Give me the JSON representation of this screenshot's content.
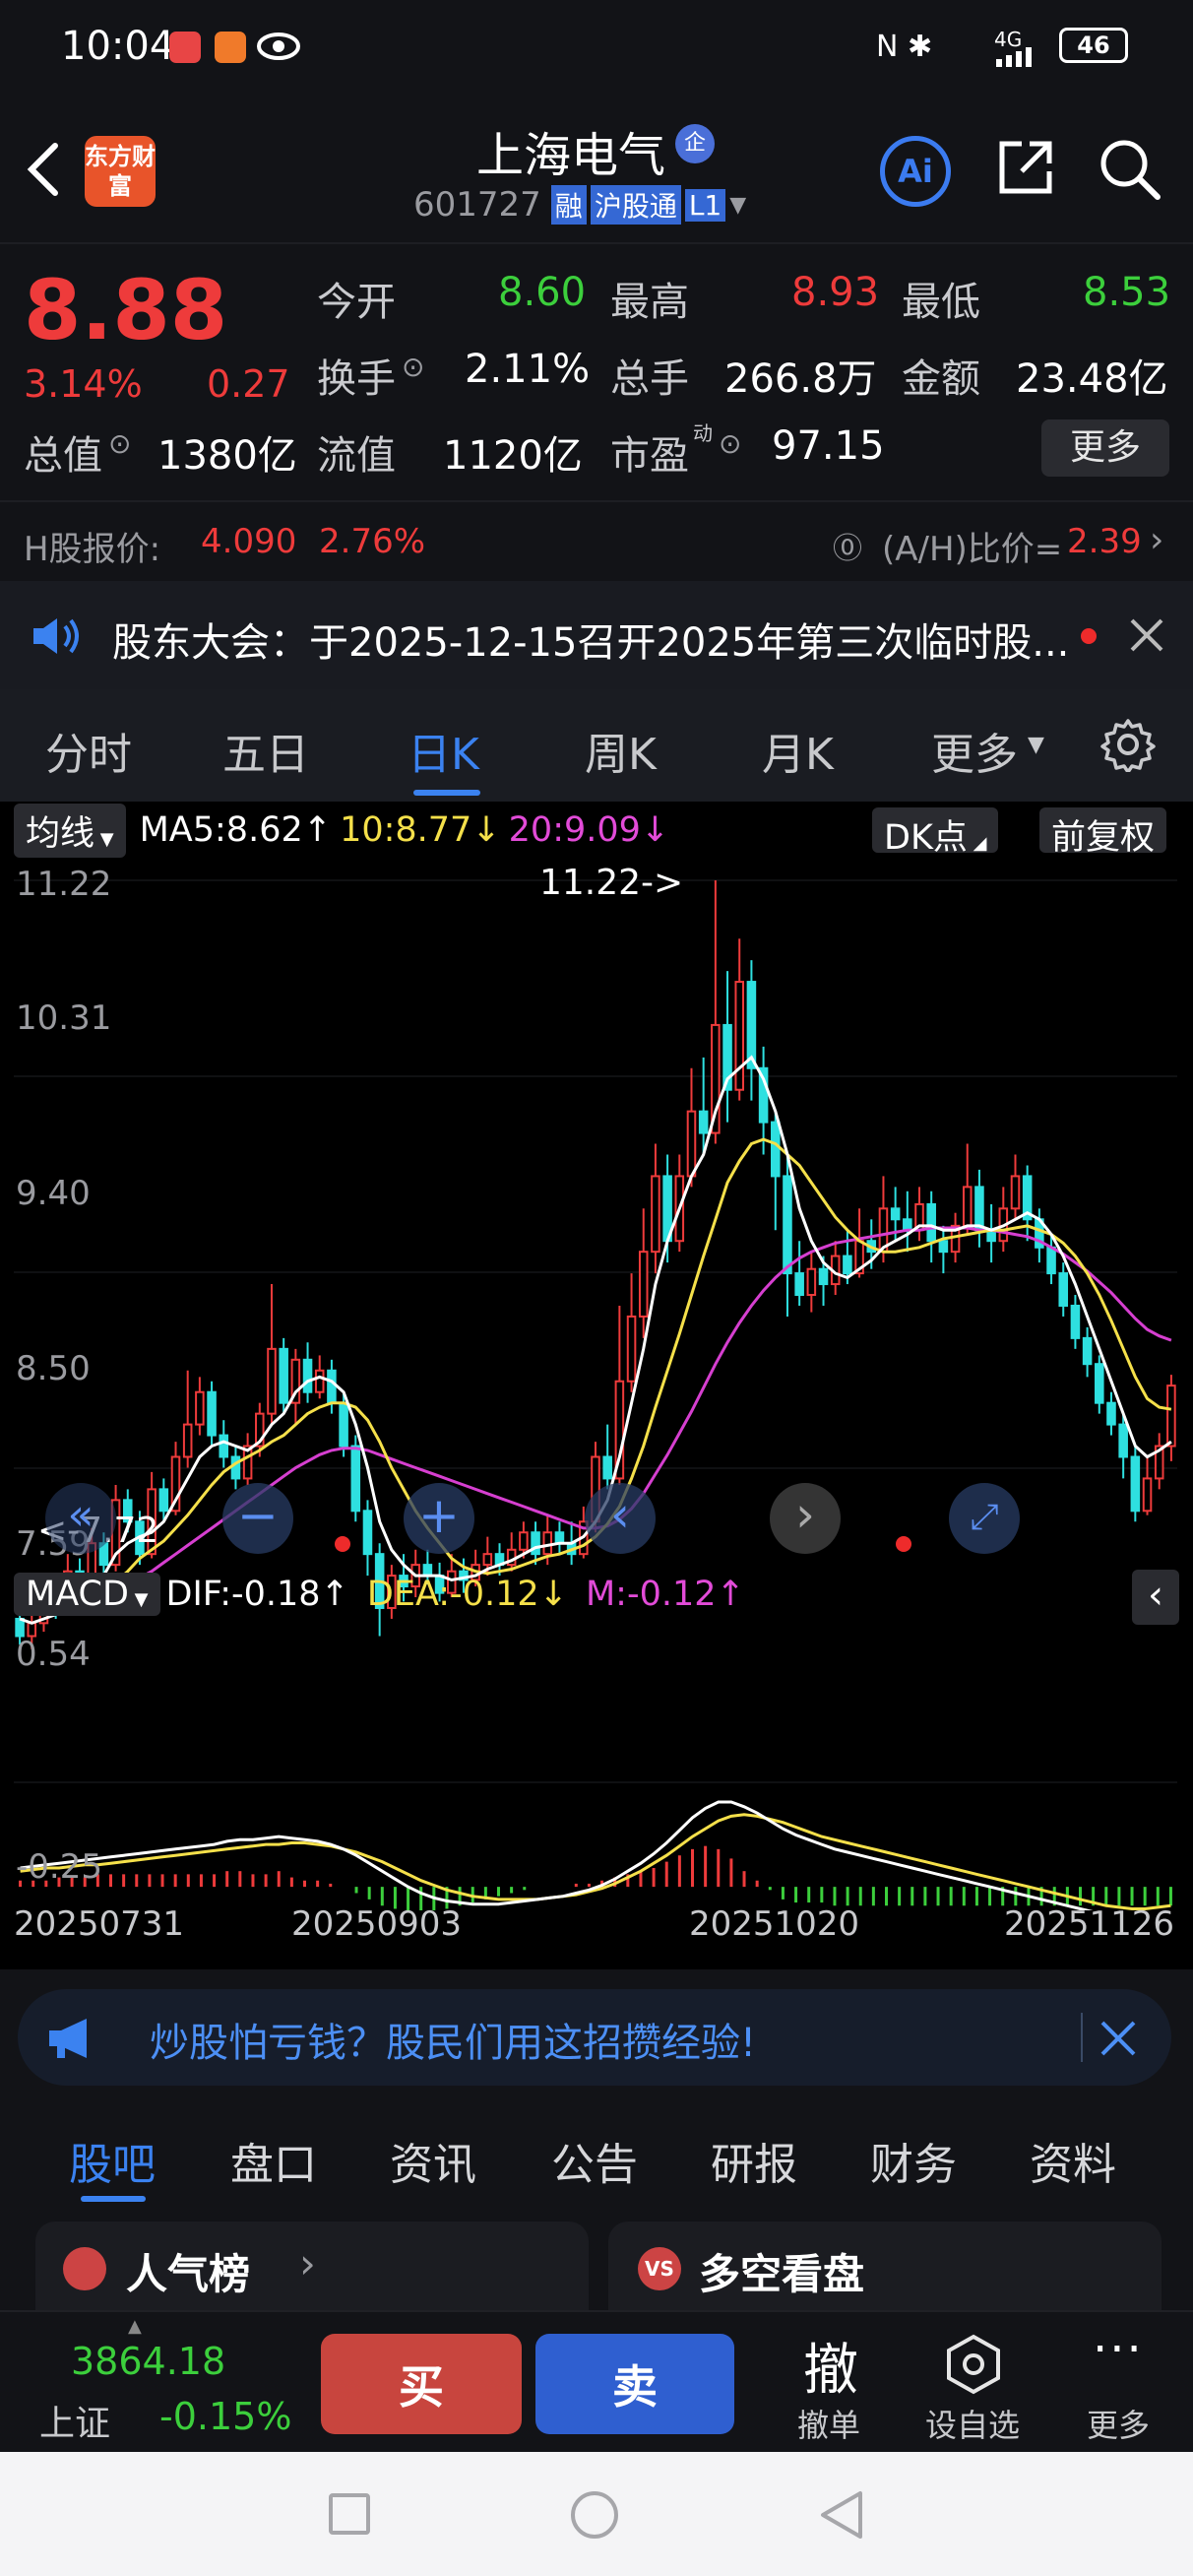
{
  "status_bar": {
    "time": "10:04",
    "net": "4G",
    "battery": "46"
  },
  "header": {
    "title": "上海电气",
    "badge": "企",
    "code": "601727",
    "tags": [
      "融",
      "沪股通",
      "L1"
    ],
    "logo_text": "东方财富",
    "ai_label": "Ai"
  },
  "quote": {
    "price": "8.88",
    "change_pct": "3.14%",
    "change_amt": "0.27",
    "open_label": "今开",
    "open": "8.60",
    "high_label": "最高",
    "high": "8.93",
    "low_label": "最低",
    "low": "8.53",
    "turnover_label": "换手",
    "turnover": "2.11%",
    "volume_label": "总手",
    "volume": "266.8万",
    "amount_label": "金额",
    "amount": "23.48亿",
    "mktcap_label": "总值",
    "mktcap": "1380亿",
    "float_label": "流值",
    "float_cap": "1120亿",
    "pe_label": "市盈",
    "pe_sup": "动",
    "pe": "97.15",
    "more_label": "更多"
  },
  "hshare": {
    "label": "H股报价:",
    "price": "4.090",
    "change": "2.76%",
    "ratio_label": "(A/H)比价=",
    "ratio": "2.39"
  },
  "notice": {
    "text": "股东大会：于2025-12-15召开2025年第三次临时股..."
  },
  "period_tabs": [
    "分时",
    "五日",
    "日K",
    "周K",
    "月K",
    "更多"
  ],
  "active_tab": "日K",
  "ma_bar": {
    "type": "均线",
    "ma5": "MA5:8.62",
    "ma10": "10:8.77",
    "ma20": "20:9.09",
    "dk": "DK点",
    "adj": "前复权"
  },
  "price_axis": [
    "11.22",
    "10.31",
    "9.40",
    "8.50",
    "7.59"
  ],
  "annotations": {
    "max": "11.22->",
    "min": "<-7.72"
  },
  "macd_bar": {
    "type": "MACD",
    "dif": "DIF:-0.18",
    "dea": "DEA:-0.12",
    "m": "M:-0.12"
  },
  "macd_axis": [
    "0.54",
    "-0.25"
  ],
  "date_axis": [
    "20250731",
    "20250903",
    "20251020",
    "20251126"
  ],
  "ad": {
    "text": "炒股怕亏钱？股民们用这招攒经验!"
  },
  "sub_tabs": [
    "股吧",
    "盘口",
    "资讯",
    "公告",
    "研报",
    "财务",
    "资料"
  ],
  "active_sub_tab": "股吧",
  "cards": {
    "popular": "人气榜",
    "bullbear": "多空看盘"
  },
  "bottom": {
    "index_value": "3864.18",
    "index_name": "上证",
    "index_change": "-0.15%",
    "buy": "买",
    "sell": "卖",
    "cancel_icon": "撤",
    "cancel": "撤单",
    "watch": "设自选",
    "more": "更多"
  },
  "colors": {
    "up": "#ee3b3b",
    "down": "#2ee0e0",
    "ma5": "#ffffff",
    "ma10": "#f5e04a",
    "ma20": "#d63fd0",
    "accent": "#3b82f0"
  },
  "chart_data": {
    "type": "candlestick",
    "ylim": [
      7.59,
      11.22
    ],
    "annotations": {
      "max": 11.22,
      "min": 7.72
    },
    "candles": [
      [
        7.8,
        7.72,
        7.95,
        7.68
      ],
      [
        7.72,
        7.78,
        7.85,
        7.66
      ],
      [
        7.78,
        7.9,
        7.98,
        7.74
      ],
      [
        7.9,
        7.84,
        7.96,
        7.8
      ],
      [
        7.84,
        8.02,
        8.1,
        7.82
      ],
      [
        8.02,
        7.95,
        8.08,
        7.9
      ],
      [
        7.95,
        8.15,
        8.22,
        7.92
      ],
      [
        8.15,
        8.05,
        8.2,
        8.0
      ],
      [
        8.05,
        8.35,
        8.42,
        8.02
      ],
      [
        8.35,
        8.25,
        8.4,
        8.2
      ],
      [
        8.25,
        8.1,
        8.3,
        8.05
      ],
      [
        8.1,
        8.4,
        8.48,
        8.08
      ],
      [
        8.4,
        8.3,
        8.45,
        8.25
      ],
      [
        8.3,
        8.55,
        8.62,
        8.28
      ],
      [
        8.55,
        8.7,
        8.95,
        8.5
      ],
      [
        8.7,
        8.85,
        8.92,
        8.65
      ],
      [
        8.85,
        8.65,
        8.9,
        8.6
      ],
      [
        8.65,
        8.55,
        8.72,
        8.5
      ],
      [
        8.55,
        8.45,
        8.6,
        8.4
      ],
      [
        8.45,
        8.6,
        8.66,
        8.42
      ],
      [
        8.6,
        8.75,
        8.8,
        8.55
      ],
      [
        8.75,
        9.05,
        9.35,
        8.7
      ],
      [
        9.05,
        8.8,
        9.1,
        8.75
      ],
      [
        8.8,
        9.0,
        9.05,
        8.7
      ],
      [
        9.0,
        8.85,
        9.08,
        8.8
      ],
      [
        8.85,
        8.95,
        9.02,
        8.82
      ],
      [
        8.95,
        8.8,
        9.0,
        8.75
      ],
      [
        8.8,
        8.6,
        8.85,
        8.55
      ],
      [
        8.6,
        8.3,
        8.65,
        8.25
      ],
      [
        8.3,
        8.1,
        8.35,
        8.0
      ],
      [
        8.1,
        7.85,
        8.15,
        7.72
      ],
      [
        7.85,
        8.0,
        8.05,
        7.8
      ],
      [
        8.0,
        7.95,
        8.1,
        7.88
      ],
      [
        7.95,
        8.05,
        8.12,
        7.9
      ],
      [
        8.05,
        8.0,
        8.12,
        7.96
      ],
      [
        8.0,
        7.92,
        8.06,
        7.88
      ],
      [
        7.92,
        8.02,
        8.1,
        7.9
      ],
      [
        8.02,
        7.98,
        8.08,
        7.92
      ],
      [
        7.98,
        8.05,
        8.12,
        7.95
      ],
      [
        8.05,
        8.1,
        8.18,
        8.0
      ],
      [
        8.1,
        8.05,
        8.15,
        8.0
      ],
      [
        8.05,
        8.12,
        8.2,
        8.02
      ],
      [
        8.12,
        8.2,
        8.25,
        8.08
      ],
      [
        8.2,
        8.1,
        8.25,
        8.05
      ],
      [
        8.1,
        8.2,
        8.28,
        8.05
      ],
      [
        8.2,
        8.15,
        8.25,
        8.1
      ],
      [
        8.15,
        8.1,
        8.25,
        8.05
      ],
      [
        8.1,
        8.25,
        8.32,
        8.08
      ],
      [
        8.25,
        8.55,
        8.62,
        8.2
      ],
      [
        8.55,
        8.45,
        8.7,
        8.4
      ],
      [
        8.45,
        8.9,
        9.25,
        8.42
      ],
      [
        8.9,
        9.2,
        9.4,
        8.85
      ],
      [
        9.2,
        9.5,
        9.7,
        9.1
      ],
      [
        9.5,
        9.85,
        10.0,
        9.4
      ],
      [
        9.85,
        9.55,
        9.95,
        9.45
      ],
      [
        9.55,
        9.85,
        9.95,
        9.5
      ],
      [
        9.85,
        10.15,
        10.35,
        9.8
      ],
      [
        10.15,
        10.05,
        10.4,
        9.95
      ],
      [
        10.05,
        10.55,
        11.22,
        10.0
      ],
      [
        10.55,
        10.25,
        10.8,
        10.1
      ],
      [
        10.25,
        10.75,
        10.95,
        10.2
      ],
      [
        10.75,
        10.35,
        10.85,
        10.2
      ],
      [
        10.35,
        10.1,
        10.45,
        9.95
      ],
      [
        10.1,
        9.85,
        10.15,
        9.6
      ],
      [
        9.85,
        9.4,
        9.95,
        9.2
      ],
      [
        9.4,
        9.3,
        9.55,
        9.25
      ],
      [
        9.3,
        9.42,
        9.5,
        9.22
      ],
      [
        9.42,
        9.35,
        9.48,
        9.25
      ],
      [
        9.35,
        9.48,
        9.55,
        9.3
      ],
      [
        9.48,
        9.4,
        9.6,
        9.35
      ],
      [
        9.4,
        9.55,
        9.7,
        9.38
      ],
      [
        9.55,
        9.5,
        9.65,
        9.42
      ],
      [
        9.5,
        9.7,
        9.85,
        9.45
      ],
      [
        9.7,
        9.65,
        9.8,
        9.55
      ],
      [
        9.65,
        9.6,
        9.78,
        9.5
      ],
      [
        9.6,
        9.72,
        9.8,
        9.55
      ],
      [
        9.72,
        9.55,
        9.78,
        9.45
      ],
      [
        9.55,
        9.5,
        9.62,
        9.4
      ],
      [
        9.5,
        9.62,
        9.68,
        9.45
      ],
      [
        9.62,
        9.8,
        10.0,
        9.58
      ],
      [
        9.8,
        9.6,
        9.88,
        9.52
      ],
      [
        9.6,
        9.55,
        9.72,
        9.45
      ],
      [
        9.55,
        9.7,
        9.8,
        9.5
      ],
      [
        9.7,
        9.85,
        9.95,
        9.65
      ],
      [
        9.85,
        9.65,
        9.9,
        9.55
      ],
      [
        9.65,
        9.52,
        9.7,
        9.45
      ],
      [
        9.52,
        9.4,
        9.58,
        9.35
      ],
      [
        9.4,
        9.25,
        9.45,
        9.2
      ],
      [
        9.25,
        9.1,
        9.3,
        9.05
      ],
      [
        9.1,
        8.98,
        9.15,
        8.92
      ],
      [
        8.98,
        8.8,
        9.02,
        8.75
      ],
      [
        8.8,
        8.7,
        8.85,
        8.65
      ],
      [
        8.7,
        8.55,
        8.75,
        8.45
      ],
      [
        8.55,
        8.3,
        8.6,
        8.25
      ],
      [
        8.3,
        8.45,
        8.55,
        8.28
      ],
      [
        8.45,
        8.6,
        8.66,
        8.4
      ],
      [
        8.6,
        8.88,
        8.93,
        8.53
      ]
    ],
    "ma5": [
      7.8,
      7.78,
      7.8,
      7.82,
      7.85,
      7.9,
      7.95,
      8.0,
      8.1,
      8.15,
      8.18,
      8.2,
      8.25,
      8.35,
      8.45,
      8.55,
      8.6,
      8.62,
      8.6,
      8.58,
      8.62,
      8.7,
      8.75,
      8.85,
      8.9,
      8.92,
      8.9,
      8.85,
      8.7,
      8.5,
      8.25,
      8.12,
      8.05,
      8.0,
      8.0,
      8.0,
      7.98,
      7.99,
      8.0,
      8.03,
      8.05,
      8.07,
      8.1,
      8.13,
      8.14,
      8.15,
      8.15,
      8.18,
      8.25,
      8.35,
      8.55,
      8.8,
      9.05,
      9.35,
      9.55,
      9.7,
      9.85,
      9.95,
      10.15,
      10.3,
      10.35,
      10.4,
      10.3,
      10.15,
      9.95,
      9.7,
      9.55,
      9.45,
      9.4,
      9.38,
      9.42,
      9.46,
      9.52,
      9.55,
      9.58,
      9.62,
      9.62,
      9.6,
      9.6,
      9.62,
      9.62,
      9.6,
      9.62,
      9.65,
      9.68,
      9.65,
      9.58,
      9.48,
      9.35,
      9.2,
      9.05,
      8.9,
      8.75,
      8.6,
      8.55,
      8.58,
      8.62
    ],
    "ma10": [
      7.85,
      7.83,
      7.82,
      7.83,
      7.84,
      7.86,
      7.88,
      7.92,
      7.97,
      8.02,
      8.08,
      8.12,
      8.16,
      8.22,
      8.28,
      8.35,
      8.42,
      8.48,
      8.52,
      8.55,
      8.58,
      8.62,
      8.65,
      8.7,
      8.75,
      8.78,
      8.8,
      8.8,
      8.78,
      8.72,
      8.62,
      8.5,
      8.4,
      8.3,
      8.22,
      8.15,
      8.08,
      8.04,
      8.02,
      8.01,
      8.02,
      8.03,
      8.05,
      8.07,
      8.09,
      8.1,
      8.12,
      8.14,
      8.18,
      8.24,
      8.32,
      8.45,
      8.6,
      8.78,
      8.95,
      9.12,
      9.3,
      9.48,
      9.65,
      9.82,
      9.92,
      10.0,
      10.02,
      10.0,
      9.95,
      9.9,
      9.82,
      9.74,
      9.66,
      9.6,
      9.55,
      9.52,
      9.5,
      9.5,
      9.51,
      9.52,
      9.54,
      9.56,
      9.57,
      9.58,
      9.59,
      9.6,
      9.6,
      9.61,
      9.62,
      9.6,
      9.58,
      9.54,
      9.48,
      9.4,
      9.3,
      9.18,
      9.05,
      8.92,
      8.82,
      8.78,
      8.77
    ],
    "ma20": [
      7.95,
      7.93,
      7.91,
      7.9,
      7.89,
      7.89,
      7.9,
      7.91,
      7.93,
      7.96,
      7.99,
      8.02,
      8.06,
      8.1,
      8.14,
      8.18,
      8.22,
      8.26,
      8.3,
      8.34,
      8.38,
      8.42,
      8.46,
      8.5,
      8.53,
      8.56,
      8.58,
      8.59,
      8.59,
      8.58,
      8.56,
      8.54,
      8.52,
      8.5,
      8.48,
      8.46,
      8.44,
      8.42,
      8.4,
      8.38,
      8.36,
      8.34,
      8.32,
      8.3,
      8.28,
      8.26,
      8.24,
      8.22,
      8.22,
      8.23,
      8.26,
      8.31,
      8.38,
      8.47,
      8.56,
      8.66,
      8.76,
      8.87,
      8.98,
      9.08,
      9.17,
      9.25,
      9.32,
      9.38,
      9.43,
      9.47,
      9.5,
      9.52,
      9.54,
      9.55,
      9.56,
      9.57,
      9.58,
      9.59,
      9.6,
      9.6,
      9.61,
      9.61,
      9.61,
      9.61,
      9.6,
      9.6,
      9.59,
      9.58,
      9.57,
      9.55,
      9.52,
      9.49,
      9.45,
      9.41,
      9.36,
      9.31,
      9.25,
      9.19,
      9.14,
      9.11,
      9.09
    ],
    "macd_ylim": [
      -0.25,
      0.54
    ],
    "dif": [
      0.12,
      0.13,
      0.14,
      0.15,
      0.16,
      0.17,
      0.18,
      0.19,
      0.2,
      0.21,
      0.22,
      0.23,
      0.24,
      0.25,
      0.26,
      0.27,
      0.29,
      0.3,
      0.3,
      0.31,
      0.32,
      0.31,
      0.3,
      0.29,
      0.27,
      0.24,
      0.2,
      0.15,
      0.1,
      0.05,
      0.0,
      -0.04,
      -0.07,
      -0.09,
      -0.1,
      -0.11,
      -0.11,
      -0.11,
      -0.1,
      -0.09,
      -0.08,
      -0.07,
      -0.06,
      -0.04,
      -0.02,
      0.01,
      0.05,
      0.1,
      0.15,
      0.21,
      0.28,
      0.36,
      0.44,
      0.5,
      0.54,
      0.54,
      0.51,
      0.47,
      0.42,
      0.37,
      0.33,
      0.3,
      0.27,
      0.24,
      0.22,
      0.2,
      0.18,
      0.16,
      0.14,
      0.12,
      0.1,
      0.08,
      0.06,
      0.04,
      0.02,
      0.0,
      -0.02,
      -0.04,
      -0.06,
      -0.08,
      -0.1,
      -0.12,
      -0.14,
      -0.16,
      -0.18,
      -0.19,
      -0.2,
      -0.2,
      -0.19,
      -0.18
    ],
    "dea": [
      0.1,
      0.11,
      0.12,
      0.12,
      0.13,
      0.14,
      0.14,
      0.15,
      0.16,
      0.17,
      0.18,
      0.19,
      0.2,
      0.21,
      0.22,
      0.23,
      0.24,
      0.25,
      0.26,
      0.27,
      0.27,
      0.28,
      0.28,
      0.27,
      0.26,
      0.24,
      0.22,
      0.19,
      0.16,
      0.12,
      0.08,
      0.04,
      0.01,
      -0.02,
      -0.04,
      -0.06,
      -0.07,
      -0.08,
      -0.08,
      -0.08,
      -0.08,
      -0.07,
      -0.06,
      -0.05,
      -0.03,
      -0.01,
      0.02,
      0.06,
      0.1,
      0.15,
      0.2,
      0.26,
      0.32,
      0.37,
      0.42,
      0.45,
      0.46,
      0.45,
      0.43,
      0.41,
      0.38,
      0.35,
      0.32,
      0.3,
      0.28,
      0.26,
      0.24,
      0.22,
      0.2,
      0.18,
      0.16,
      0.14,
      0.12,
      0.1,
      0.08,
      0.06,
      0.04,
      0.02,
      0.0,
      -0.02,
      -0.04,
      -0.06,
      -0.08,
      -0.1,
      -0.12,
      -0.13,
      -0.14,
      -0.14,
      -0.13,
      -0.12
    ]
  }
}
